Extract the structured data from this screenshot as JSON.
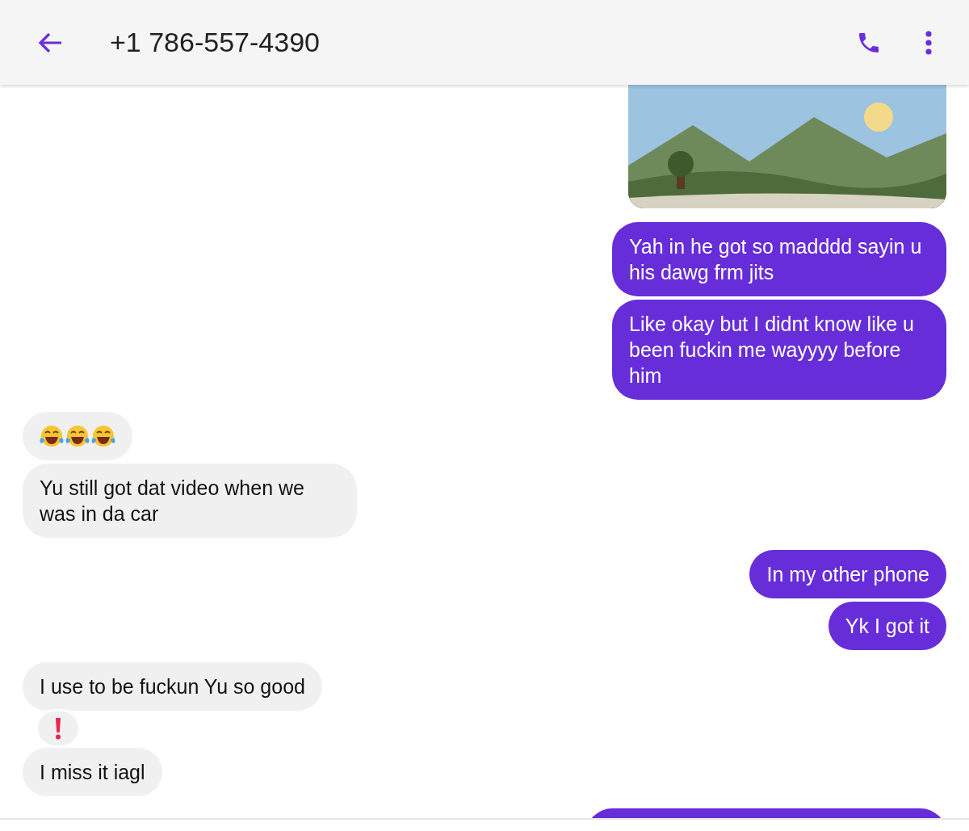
{
  "header": {
    "title": "+1 786-557-4390"
  },
  "messages": [
    {
      "outgoing": true,
      "kind": "picture"
    },
    {
      "outgoing": true,
      "kind": "text",
      "text": "Yah in he got so madddd sayin u his dawg frm jits"
    },
    {
      "outgoing": true,
      "kind": "text",
      "text": "Like okay but I didnt know like u been fuckin me wayyyy before him"
    },
    {
      "outgoing": false,
      "kind": "emoji"
    },
    {
      "outgoing": false,
      "kind": "text",
      "text": "Yu still got dat video when we was in da car"
    },
    {
      "outgoing": true,
      "kind": "text",
      "text": "In my other phone"
    },
    {
      "outgoing": true,
      "kind": "text",
      "text": "Yk I got it"
    },
    {
      "outgoing": false,
      "kind": "text",
      "text": "I use to be fuckun Yu so good"
    },
    {
      "outgoing": false,
      "kind": "reaction"
    },
    {
      "outgoing": false,
      "kind": "text",
      "text": "I miss it iagl"
    },
    {
      "outgoing": true,
      "kind": "partial"
    }
  ]
}
